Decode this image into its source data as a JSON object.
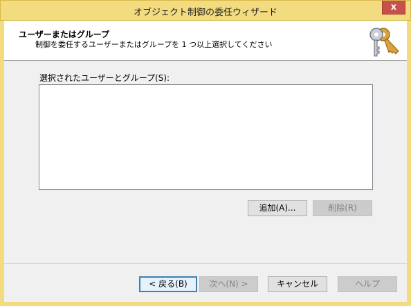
{
  "window": {
    "title": "オブジェクト制御の委任ウィザード",
    "close_label": "x"
  },
  "header": {
    "title": "ユーザーまたはグループ",
    "subtitle": "制御を委任するユーザーまたはグループを 1 つ以上選択してください",
    "icon": "keys-icon"
  },
  "main": {
    "list_label": "選択されたユーザーとグループ(S):",
    "items": [],
    "add_label": "追加(A)...",
    "remove_label": "削除(R)"
  },
  "footer": {
    "back_label": "< 戻る(B)",
    "next_label": "次へ(N) >",
    "cancel_label": "キャンセル",
    "help_label": "ヘルプ"
  },
  "colors": {
    "titlebar": "#f3dc80",
    "close": "#c7504a"
  }
}
